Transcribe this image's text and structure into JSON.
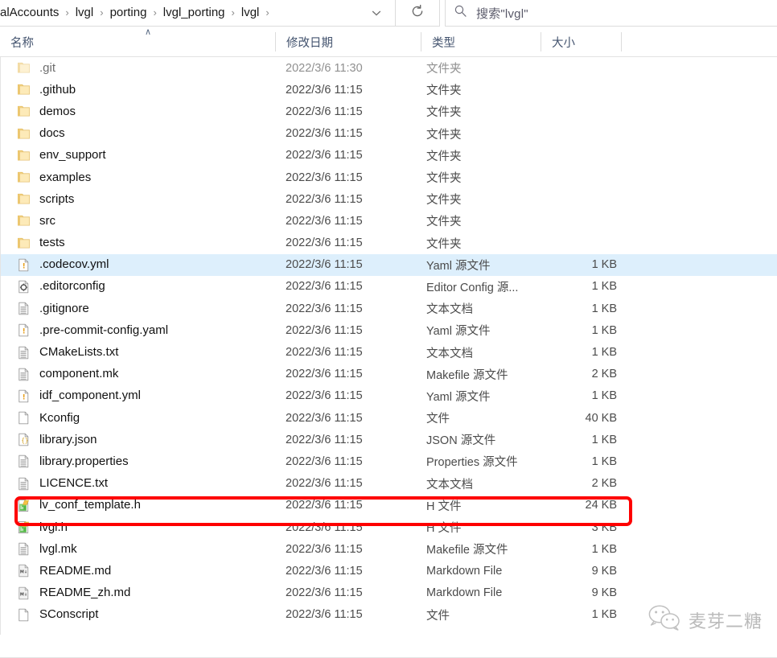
{
  "navbar": {
    "breadcrumbs": [
      {
        "label": "alAccounts"
      },
      {
        "label": "lvgl"
      },
      {
        "label": "porting"
      },
      {
        "label": "lvgl_porting"
      },
      {
        "label": "lvgl"
      }
    ],
    "separator": "›",
    "dropdown_icon": "chevron-down-icon",
    "refresh_icon": "refresh-icon",
    "search": {
      "icon": "search-icon",
      "placeholder": "搜索\"lvgl\""
    }
  },
  "columns": {
    "name": "名称",
    "date_modified": "修改日期",
    "type": "类型",
    "size": "大小",
    "sort_indicator": "∧"
  },
  "rows": [
    {
      "name": ".git",
      "date": "2022/3/6 11:30",
      "type": "文件夹",
      "size": "",
      "icon": "folder-icon",
      "selected": false,
      "dim": true
    },
    {
      "name": ".github",
      "date": "2022/3/6 11:15",
      "type": "文件夹",
      "size": "",
      "icon": "folder-icon",
      "selected": false,
      "dim": false
    },
    {
      "name": "demos",
      "date": "2022/3/6 11:15",
      "type": "文件夹",
      "size": "",
      "icon": "folder-icon",
      "selected": false,
      "dim": false
    },
    {
      "name": "docs",
      "date": "2022/3/6 11:15",
      "type": "文件夹",
      "size": "",
      "icon": "folder-icon",
      "selected": false,
      "dim": false
    },
    {
      "name": "env_support",
      "date": "2022/3/6 11:15",
      "type": "文件夹",
      "size": "",
      "icon": "folder-icon",
      "selected": false,
      "dim": false
    },
    {
      "name": "examples",
      "date": "2022/3/6 11:15",
      "type": "文件夹",
      "size": "",
      "icon": "folder-icon",
      "selected": false,
      "dim": false
    },
    {
      "name": "scripts",
      "date": "2022/3/6 11:15",
      "type": "文件夹",
      "size": "",
      "icon": "folder-icon",
      "selected": false,
      "dim": false
    },
    {
      "name": "src",
      "date": "2022/3/6 11:15",
      "type": "文件夹",
      "size": "",
      "icon": "folder-icon",
      "selected": false,
      "dim": false
    },
    {
      "name": "tests",
      "date": "2022/3/6 11:15",
      "type": "文件夹",
      "size": "",
      "icon": "folder-icon",
      "selected": false,
      "dim": false
    },
    {
      "name": ".codecov.yml",
      "date": "2022/3/6 11:15",
      "type": "Yaml 源文件",
      "size": "1 KB",
      "icon": "yaml-file-icon",
      "selected": true,
      "dim": false
    },
    {
      "name": ".editorconfig",
      "date": "2022/3/6 11:15",
      "type": "Editor Config 源...",
      "size": "1 KB",
      "icon": "config-file-icon",
      "selected": false,
      "dim": false
    },
    {
      "name": ".gitignore",
      "date": "2022/3/6 11:15",
      "type": "文本文档",
      "size": "1 KB",
      "icon": "text-file-icon",
      "selected": false,
      "dim": false
    },
    {
      "name": ".pre-commit-config.yaml",
      "date": "2022/3/6 11:15",
      "type": "Yaml 源文件",
      "size": "1 KB",
      "icon": "yaml-file-icon",
      "selected": false,
      "dim": false
    },
    {
      "name": "CMakeLists.txt",
      "date": "2022/3/6 11:15",
      "type": "文本文档",
      "size": "1 KB",
      "icon": "text-file-icon",
      "selected": false,
      "dim": false
    },
    {
      "name": "component.mk",
      "date": "2022/3/6 11:15",
      "type": "Makefile 源文件",
      "size": "2 KB",
      "icon": "text-file-icon",
      "selected": false,
      "dim": false
    },
    {
      "name": "idf_component.yml",
      "date": "2022/3/6 11:15",
      "type": "Yaml 源文件",
      "size": "1 KB",
      "icon": "yaml-file-icon",
      "selected": false,
      "dim": false
    },
    {
      "name": "Kconfig",
      "date": "2022/3/6 11:15",
      "type": "文件",
      "size": "40 KB",
      "icon": "blank-file-icon",
      "selected": false,
      "dim": false
    },
    {
      "name": "library.json",
      "date": "2022/3/6 11:15",
      "type": "JSON 源文件",
      "size": "1 KB",
      "icon": "json-file-icon",
      "selected": false,
      "dim": false
    },
    {
      "name": "library.properties",
      "date": "2022/3/6 11:15",
      "type": "Properties 源文件",
      "size": "1 KB",
      "icon": "text-file-icon",
      "selected": false,
      "dim": false
    },
    {
      "name": "LICENCE.txt",
      "date": "2022/3/6 11:15",
      "type": "文本文档",
      "size": "2 KB",
      "icon": "text-file-icon",
      "selected": false,
      "dim": false
    },
    {
      "name": "lv_conf_template.h",
      "date": "2022/3/6 11:15",
      "type": "H 文件",
      "size": "24 KB",
      "icon": "header-file-icon",
      "selected": false,
      "dim": false
    },
    {
      "name": "lvgl.h",
      "date": "2022/3/6 11:15",
      "type": "H 文件",
      "size": "3 KB",
      "icon": "header-file-icon",
      "selected": false,
      "dim": false
    },
    {
      "name": "lvgl.mk",
      "date": "2022/3/6 11:15",
      "type": "Makefile 源文件",
      "size": "1 KB",
      "icon": "text-file-icon",
      "selected": false,
      "dim": false
    },
    {
      "name": "README.md",
      "date": "2022/3/6 11:15",
      "type": "Markdown File",
      "size": "9 KB",
      "icon": "markdown-file-icon",
      "selected": false,
      "dim": false
    },
    {
      "name": "README_zh.md",
      "date": "2022/3/6 11:15",
      "type": "Markdown File",
      "size": "9 KB",
      "icon": "markdown-file-icon",
      "selected": false,
      "dim": false
    },
    {
      "name": "SConscript",
      "date": "2022/3/6 11:15",
      "type": "文件",
      "size": "1 KB",
      "icon": "blank-file-icon",
      "selected": false,
      "dim": false
    }
  ],
  "annotation": {
    "target_row": "lv_conf_template.h",
    "color": "#fe0000"
  },
  "watermark": {
    "icon": "wechat-icon",
    "text": "麦芽二糖"
  },
  "colors": {
    "selection": "#ddeffc",
    "header_text": "#44546f",
    "annotation": "#fe0000"
  }
}
